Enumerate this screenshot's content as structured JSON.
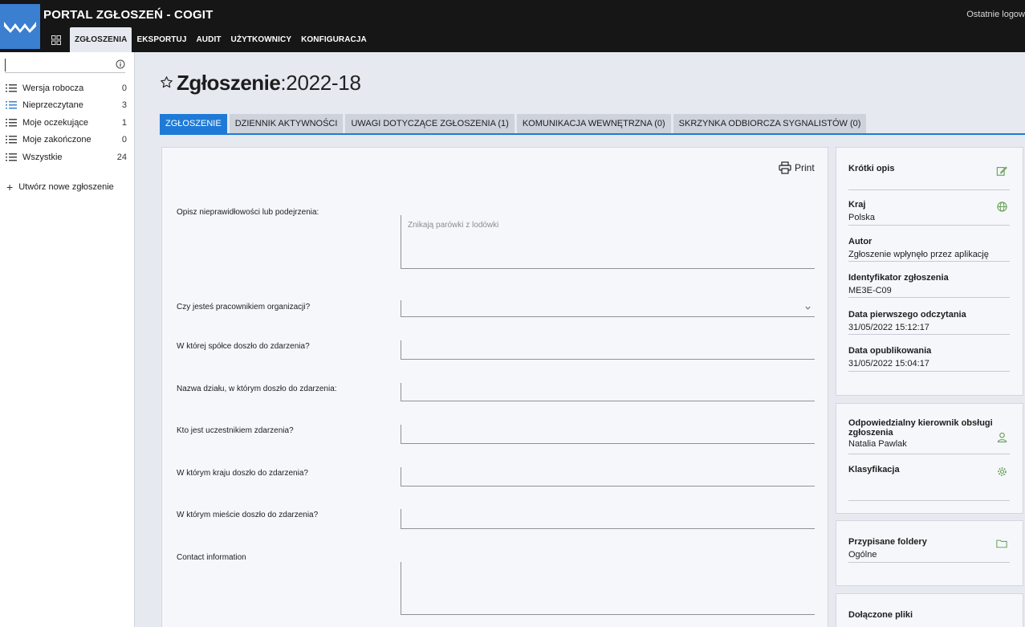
{
  "header": {
    "app_title": "PORTAL ZGŁOSZEŃ - COGIT",
    "top_right_text": "Ostatnie logow",
    "nav": [
      {
        "label": "ZGŁOSZENIA",
        "active": true
      },
      {
        "label": "EKSPORTUJ",
        "active": false
      },
      {
        "label": "AUDIT",
        "active": false
      },
      {
        "label": "UŻYTKOWNICY",
        "active": false
      },
      {
        "label": "KONFIGURACJA",
        "active": false
      }
    ]
  },
  "sidebar": {
    "search_value": "",
    "items": [
      {
        "label": "Wersja robocza",
        "count": "0"
      },
      {
        "label": "Nieprzeczytane",
        "count": "3"
      },
      {
        "label": "Moje oczekujące",
        "count": "1"
      },
      {
        "label": "Moje zakończone",
        "count": "0"
      },
      {
        "label": "Wszystkie",
        "count": "24"
      }
    ],
    "create_label": "Utwórz nowe zgłoszenie"
  },
  "page": {
    "title_bold": "Zgłoszenie",
    "title_rest": ":2022-18"
  },
  "tabs": [
    {
      "label": "ZGŁOSZENIE",
      "active": true
    },
    {
      "label": "DZIENNIK AKTYWNOŚCI",
      "active": false
    },
    {
      "label": "UWAGI DOTYCZĄCE ZGŁOSZENIA (1)",
      "active": false
    },
    {
      "label": "KOMUNIKACJA WEWNĘTRZNA (0)",
      "active": false
    },
    {
      "label": "SKRZYNKA ODBIORCZA SYGNALISTÓW (0)",
      "active": false
    }
  ],
  "form": {
    "print_label": "Print",
    "questions": [
      {
        "label": "Opisz nieprawidłowości lub podejrzenia:",
        "value": "Znikają parówki z lodówki"
      },
      {
        "label": "Czy jesteś pracownikiem organizacji?",
        "value": ""
      },
      {
        "label": "W której spółce doszło do zdarzenia?",
        "value": ""
      },
      {
        "label": "Nazwa działu, w którym doszło do zdarzenia:",
        "value": ""
      },
      {
        "label": "Kto jest uczestnikiem zdarzenia?",
        "value": ""
      },
      {
        "label": "W którym kraju doszło do zdarzenia?",
        "value": ""
      },
      {
        "label": "W którym mieście doszło do zdarzenia?",
        "value": ""
      },
      {
        "label": "Contact information",
        "value": ""
      }
    ]
  },
  "details": {
    "short_desc_label": "Krótki opis",
    "country_label": "Kraj",
    "country_value": "Polska",
    "author_label": "Autor",
    "author_value": "Zgłoszenie wpłynęło przez aplikację",
    "id_label": "Identyfikator zgłoszenia",
    "id_value": "ME3E-C09",
    "first_read_label": "Data pierwszego odczytania",
    "first_read_value": "31/05/2022 15:12:17",
    "published_label": "Data opublikowania",
    "published_value": "31/05/2022 15:04:17"
  },
  "handling": {
    "manager_label": "Odpowiedzialny kierownik obsługi zgłoszenia",
    "manager_value": "Natalia Pawlak",
    "classification_label": "Klasyfikacja"
  },
  "folders": {
    "label": "Przypisane foldery",
    "value": "Ogólne"
  },
  "attachments": {
    "label": "Dołączone pliki"
  },
  "colors": {
    "accent": "#1e7ad6",
    "icon_green": "#5a9a4a",
    "topbar": "#161616",
    "logo": "#3a7fd0"
  }
}
